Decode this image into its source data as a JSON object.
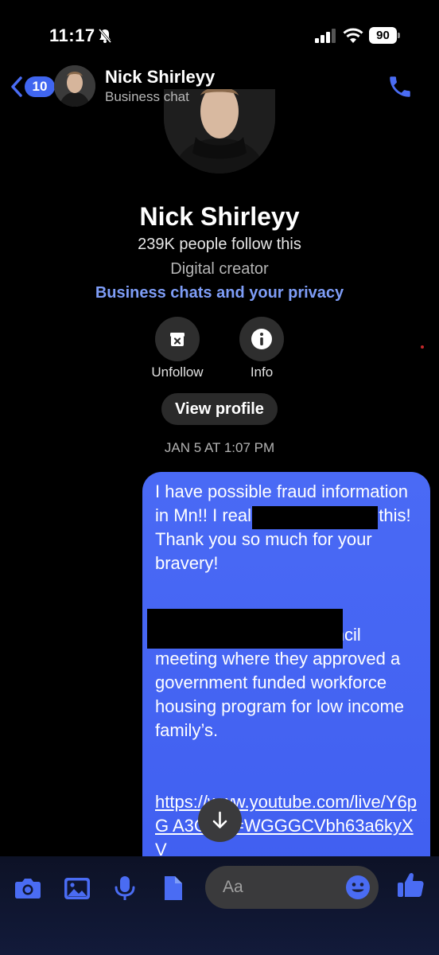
{
  "status_bar": {
    "time": "11:17",
    "battery": "90"
  },
  "header": {
    "back_count": "10",
    "name": "Nick Shirleyy",
    "subtitle": "Business chat"
  },
  "profile": {
    "name": "Nick Shirleyy",
    "followers": "239K people follow this",
    "category": "Digital creator",
    "privacy_link": "Business chats and your privacy",
    "actions": [
      {
        "label": "Unfollow",
        "icon": "unfollow-icon"
      },
      {
        "label": "Info",
        "icon": "info-icon"
      }
    ],
    "view_profile": "View profile"
  },
  "timestamp": "JAN 5 AT 1:07 PM",
  "message": {
    "paragraph1": "I have possible fraud information in                     Mn!! I really hope you see this! Thank you so much for your bravery!",
    "paragraph2": "                                        n. This link is a city council meeting where they approved a government funded workforce housing program for low income family’s.",
    "link": "https://www.youtube.com/live/Y6pG    A3CI?si=WGGGCVbh63a6kyXV"
  },
  "composer": {
    "placeholder": "Aa",
    "icons": [
      "camera-icon",
      "gallery-icon",
      "microphone-icon",
      "file-icon",
      "emoji-icon",
      "like-icon"
    ]
  },
  "colors": {
    "accent": "#4066f0",
    "bubble": "#4466f3",
    "link": "#7e9df7",
    "background": "#000000"
  }
}
